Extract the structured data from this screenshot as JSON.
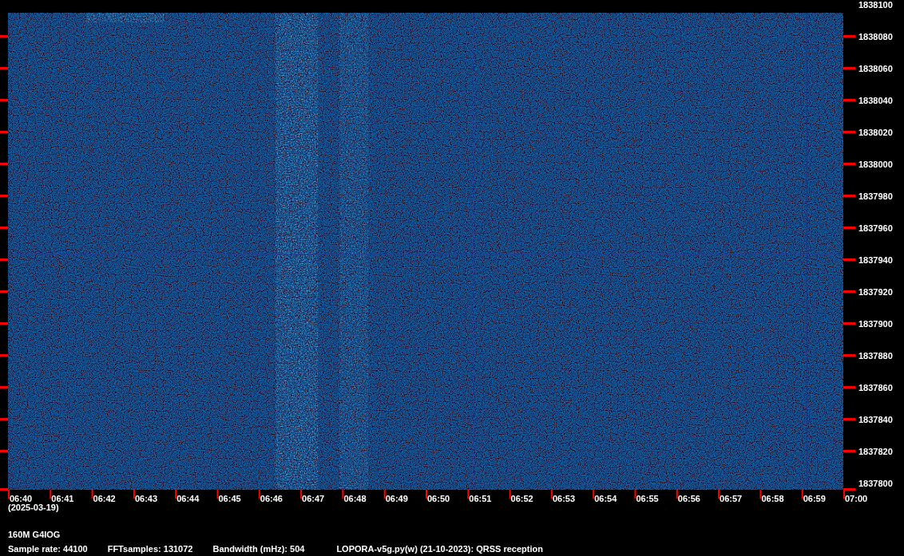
{
  "frequency_axis": [
    "1838100",
    "1838080",
    "1838060",
    "1838040",
    "1838020",
    "1838000",
    "1837980",
    "1837960",
    "1837940",
    "1837920",
    "1837900",
    "1837880",
    "1837860",
    "1837840",
    "1837820",
    "1837800"
  ],
  "time_axis": [
    "06:40",
    "06:41",
    "06:42",
    "06:43",
    "06:44",
    "06:45",
    "06:46",
    "06:47",
    "06:48",
    "06:49",
    "06:50",
    "06:51",
    "06:52",
    "06:53",
    "06:54",
    "06:55",
    "06:56",
    "06:57",
    "06:58",
    "06:59",
    "07:00"
  ],
  "date": "(2025-03-19)",
  "station": "160M G4IOG",
  "info": [
    "Sample rate: 44100",
    "FFTsamples: 131072",
    "Bandwidth (mHz): 504",
    "LOPORA-v5g.py(w) (21-10-2023): QRSS reception"
  ]
}
